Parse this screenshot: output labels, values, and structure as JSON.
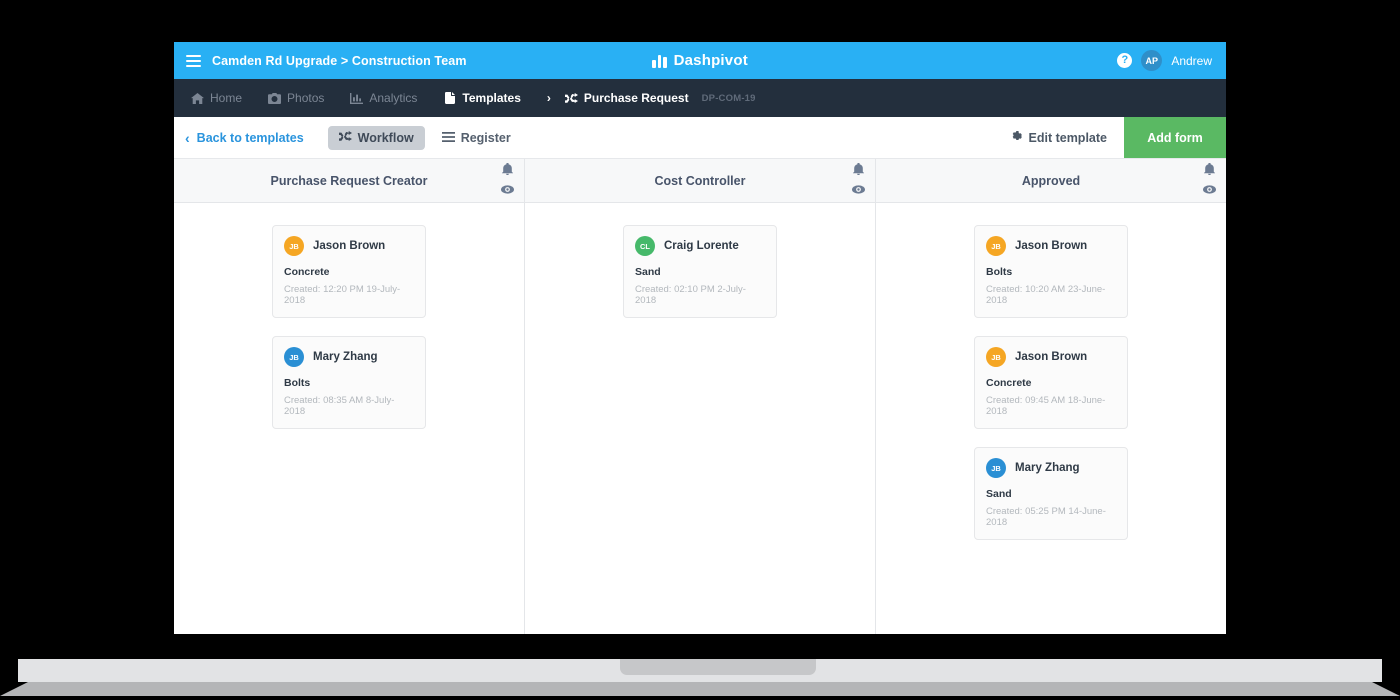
{
  "topbar": {
    "menu_icon": "hamburger-icon",
    "breadcrumb": "Camden Rd Upgrade > Construction Team",
    "brand_logo_icon": "dashpivot-bars-logo",
    "brand": "Dashpivot",
    "help_icon": "?",
    "avatar_initials": "AP",
    "user_name": "Andrew",
    "bg_color": "#29b0f4"
  },
  "navbar": {
    "bg_color": "#232f3d",
    "items": [
      {
        "label": "Home",
        "icon": "home-icon",
        "active": false
      },
      {
        "label": "Photos",
        "icon": "camera-icon",
        "active": false
      },
      {
        "label": "Analytics",
        "icon": "chart-icon",
        "active": false
      },
      {
        "label": "Templates",
        "icon": "document-icon",
        "active": true
      }
    ],
    "separator": "›",
    "current": {
      "label": "Purchase Request",
      "icon": "shuffle-icon"
    },
    "current_code": "DP-COM-19"
  },
  "toolbar": {
    "back_icon": "chevron-left-icon",
    "back_label": "Back to templates",
    "tabs": [
      {
        "label": "Workflow",
        "icon": "shuffle-icon",
        "active": true
      },
      {
        "label": "Register",
        "icon": "list-icon",
        "active": false
      }
    ],
    "edit_template_label": "Edit template",
    "edit_template_icon": "gear-icon",
    "add_form_label": "Add form",
    "add_form_color": "#5ab963"
  },
  "board": {
    "bell_icon": "bell-icon",
    "eye_icon": "eye-icon",
    "columns": [
      {
        "title": "Purchase Request Creator",
        "cards": [
          {
            "initials": "JB",
            "name": "Jason Brown",
            "avatar_color": "#f5a623",
            "subject": "Concrete",
            "created": "Created: 12:20 PM 19-July-2018"
          },
          {
            "initials": "JB",
            "name": "Mary Zhang",
            "avatar_color": "#2a8fd4",
            "subject": "Bolts",
            "created": "Created: 08:35 AM 8-July-2018"
          }
        ]
      },
      {
        "title": "Cost Controller",
        "cards": [
          {
            "initials": "CL",
            "name": "Craig Lorente",
            "avatar_color": "#46b96a",
            "subject": "Sand",
            "created": "Created: 02:10 PM 2-July-2018"
          }
        ]
      },
      {
        "title": "Approved",
        "cards": [
          {
            "initials": "JB",
            "name": "Jason Brown",
            "avatar_color": "#f5a623",
            "subject": "Bolts",
            "created": "Created: 10:20 AM 23-June-2018"
          },
          {
            "initials": "JB",
            "name": "Jason Brown",
            "avatar_color": "#f5a623",
            "subject": "Concrete",
            "created": "Created: 09:45 AM 18-June-2018"
          },
          {
            "initials": "JB",
            "name": "Mary Zhang",
            "avatar_color": "#2a8fd4",
            "subject": "Sand",
            "created": "Created: 05:25 PM 14-June-2018"
          }
        ]
      }
    ]
  }
}
